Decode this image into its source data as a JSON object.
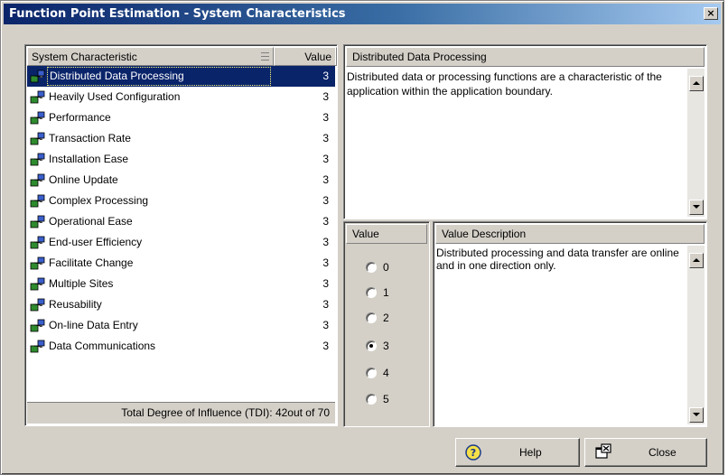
{
  "window": {
    "title": "Function Point Estimation - System Characteristics",
    "close_glyph": "×"
  },
  "list": {
    "col_characteristic": "System Characteristic",
    "col_value": "Value",
    "items": [
      {
        "label": "Distributed Data Processing",
        "value": "3",
        "selected": true
      },
      {
        "label": "Heavily Used Configuration",
        "value": "3"
      },
      {
        "label": "Performance",
        "value": "3"
      },
      {
        "label": "Transaction Rate",
        "value": "3"
      },
      {
        "label": "Installation Ease",
        "value": "3"
      },
      {
        "label": "Online Update",
        "value": "3"
      },
      {
        "label": "Complex Processing",
        "value": "3"
      },
      {
        "label": "Operational Ease",
        "value": "3"
      },
      {
        "label": "End-user Efficiency",
        "value": "3"
      },
      {
        "label": "Facilitate Change",
        "value": "3"
      },
      {
        "label": "Multiple Sites",
        "value": "3"
      },
      {
        "label": "Reusability",
        "value": "3"
      },
      {
        "label": "On-line Data Entry",
        "value": "3"
      },
      {
        "label": "Data Communications",
        "value": "3"
      }
    ],
    "total_text": "Total Degree of Influence (TDI):  42out of 70"
  },
  "description": {
    "header": "Distributed Data Processing",
    "text": "Distributed data or processing functions are a characteristic of the application within the application boundary."
  },
  "value_panel": {
    "header": "Value",
    "options": [
      "0",
      "1",
      "2",
      "3",
      "4",
      "5"
    ],
    "selected": "3"
  },
  "value_description": {
    "header": "Value Description",
    "text": "Distributed processing and data transfer are online and in one direction only."
  },
  "buttons": {
    "help": "Help",
    "close": "Close"
  },
  "icons": {
    "item_icon": "computer-network-icon",
    "help_icon": "help-question-icon",
    "close_icon": "close-window-icon"
  },
  "colors": {
    "title_start": "#0a246a",
    "title_end": "#a6caf0",
    "selection": "#0a246a",
    "face": "#d4d0c8"
  }
}
